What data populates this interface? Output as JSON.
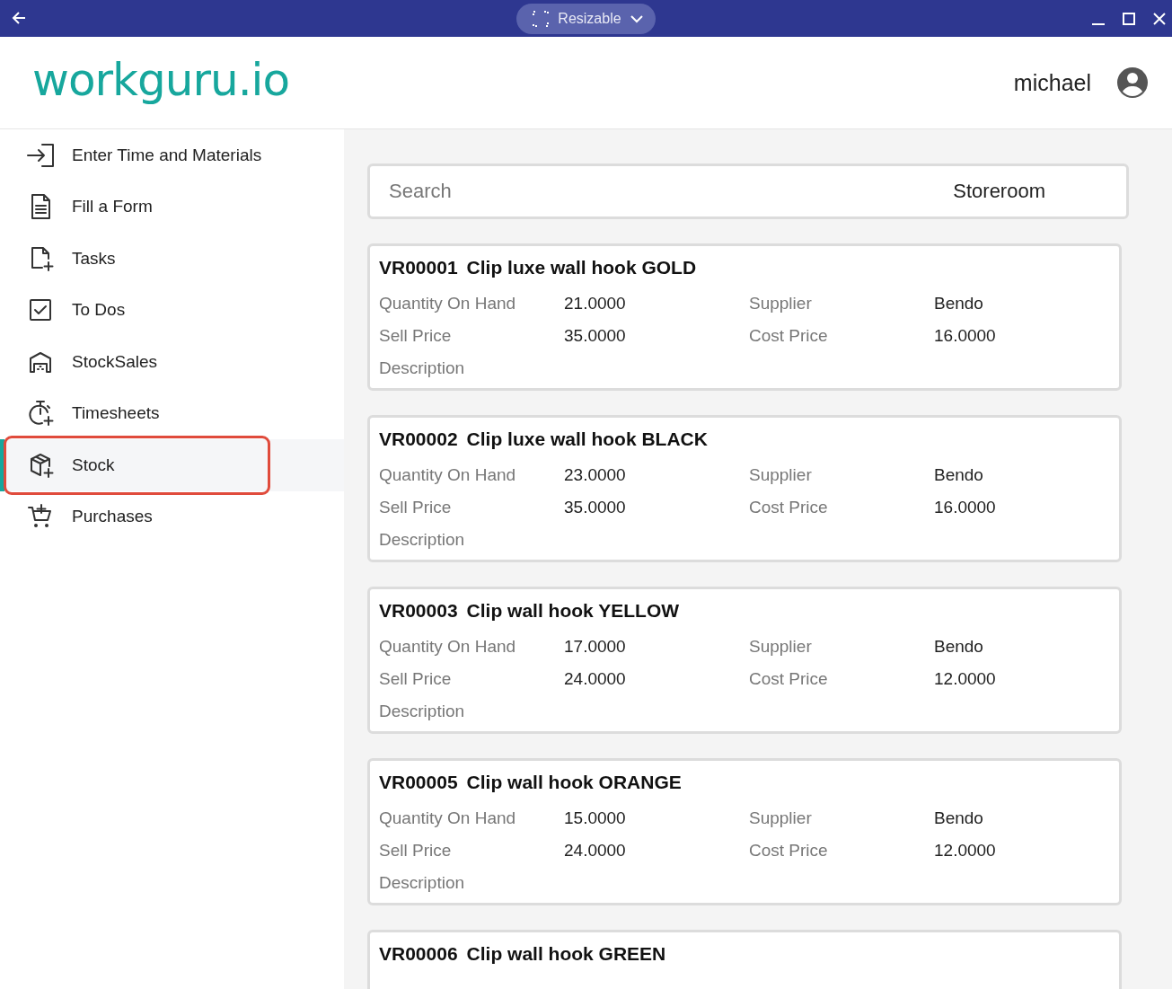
{
  "window": {
    "mode_label": "Resizable"
  },
  "brand": {
    "logo": "workguru.io"
  },
  "user": {
    "name": "michael"
  },
  "sidebar": {
    "items": [
      {
        "label": "Enter Time and Materials",
        "selected": false
      },
      {
        "label": "Fill a Form",
        "selected": false
      },
      {
        "label": "Tasks",
        "selected": false
      },
      {
        "label": "To Dos",
        "selected": false
      },
      {
        "label": "StockSales",
        "selected": false
      },
      {
        "label": "Timesheets",
        "selected": false
      },
      {
        "label": "Stock",
        "selected": true
      },
      {
        "label": "Purchases",
        "selected": false
      }
    ]
  },
  "search": {
    "placeholder": "Search",
    "location": "Storeroom"
  },
  "items": [
    {
      "code": "VR00001",
      "name": "Clip luxe wall hook GOLD",
      "fields": [
        {
          "label": "Quantity On Hand",
          "value": "21.0000"
        },
        {
          "label": "Supplier",
          "value": "Bendo"
        },
        {
          "label": "Sell Price",
          "value": "35.0000"
        },
        {
          "label": "Cost Price",
          "value": "16.0000"
        },
        {
          "label": "Description"
        }
      ]
    },
    {
      "code": "VR00002",
      "name": "Clip luxe wall hook BLACK",
      "fields": [
        {
          "label": "Quantity On Hand",
          "value": "23.0000"
        },
        {
          "label": "Supplier",
          "value": "Bendo"
        },
        {
          "label": "Sell Price",
          "value": "35.0000"
        },
        {
          "label": "Cost Price",
          "value": "16.0000"
        },
        {
          "label": "Description"
        }
      ]
    },
    {
      "code": "VR00003",
      "name": "Clip wall hook YELLOW",
      "fields": [
        {
          "label": "Quantity On Hand",
          "value": "17.0000"
        },
        {
          "label": "Supplier",
          "value": "Bendo"
        },
        {
          "label": "Sell Price",
          "value": "24.0000"
        },
        {
          "label": "Cost Price",
          "value": "12.0000"
        },
        {
          "label": "Description"
        }
      ]
    },
    {
      "code": "VR00005",
      "name": "Clip wall hook ORANGE",
      "fields": [
        {
          "label": "Quantity On Hand",
          "value": "15.0000"
        },
        {
          "label": "Supplier",
          "value": "Bendo"
        },
        {
          "label": "Sell Price",
          "value": "24.0000"
        },
        {
          "label": "Cost Price",
          "value": "12.0000"
        },
        {
          "label": "Description"
        }
      ]
    },
    {
      "code": "VR00006",
      "name": "Clip wall hook GREEN"
    }
  ]
}
